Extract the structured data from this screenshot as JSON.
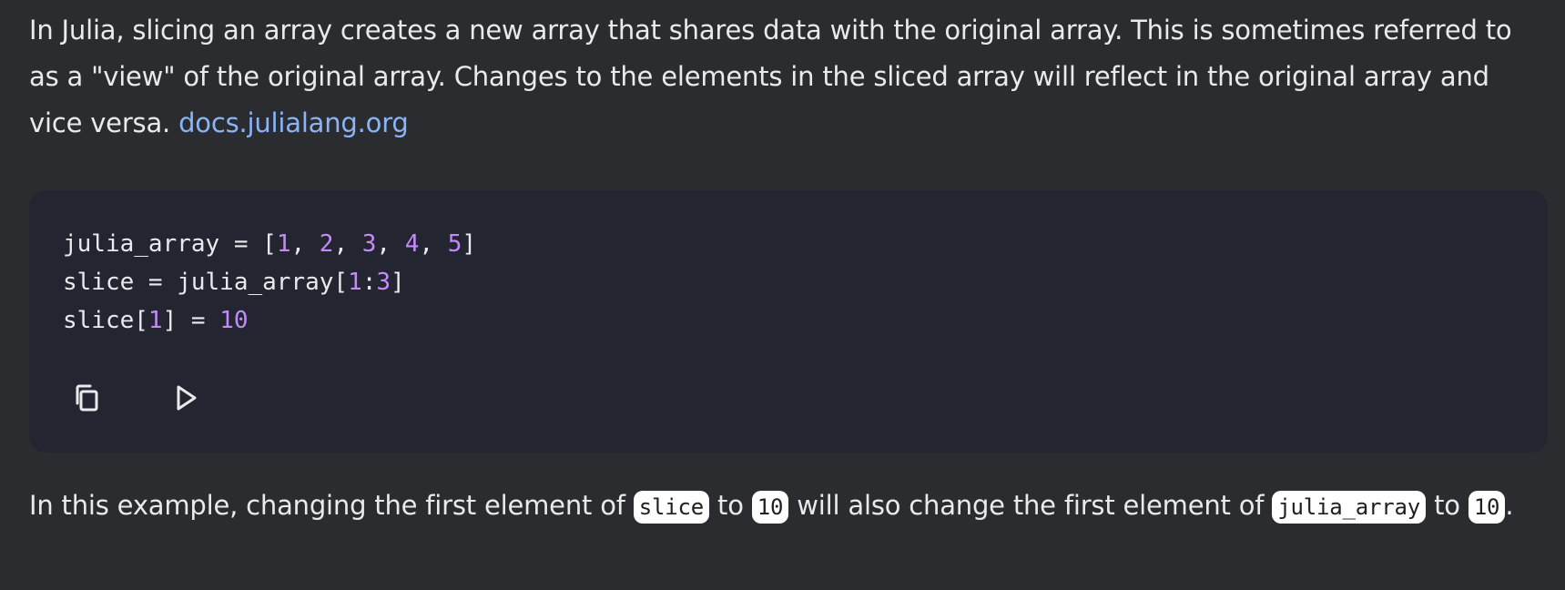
{
  "intro": {
    "text": "In Julia, slicing an array creates a new array that shares data with the original array. This is sometimes referred to as a \"view\" of the original array. Changes to the elements in the sliced array will reflect in the original array and vice versa. ",
    "link_text": "docs.julialang.org"
  },
  "code_block": {
    "lines": [
      [
        {
          "t": "julia_array = [",
          "k": "plain"
        },
        {
          "t": "1",
          "k": "num"
        },
        {
          "t": ", ",
          "k": "plain"
        },
        {
          "t": "2",
          "k": "num"
        },
        {
          "t": ", ",
          "k": "plain"
        },
        {
          "t": "3",
          "k": "num"
        },
        {
          "t": ", ",
          "k": "plain"
        },
        {
          "t": "4",
          "k": "num"
        },
        {
          "t": ", ",
          "k": "plain"
        },
        {
          "t": "5",
          "k": "num"
        },
        {
          "t": "]",
          "k": "plain"
        }
      ],
      [
        {
          "t": "slice = julia_array[",
          "k": "plain"
        },
        {
          "t": "1",
          "k": "num"
        },
        {
          "t": ":",
          "k": "plain"
        },
        {
          "t": "3",
          "k": "num"
        },
        {
          "t": "]",
          "k": "plain"
        }
      ],
      [
        {
          "t": "slice[",
          "k": "plain"
        },
        {
          "t": "1",
          "k": "num"
        },
        {
          "t": "] = ",
          "k": "plain"
        },
        {
          "t": "10",
          "k": "num"
        }
      ]
    ],
    "copy_icon": "copy-icon",
    "run_icon": "play-icon",
    "colors": {
      "background": "#232530",
      "number": "#c58af9",
      "text": "#e8eaed"
    }
  },
  "outro": {
    "part1": "In this example, changing the first element of ",
    "code1": "slice",
    "part2": " to ",
    "code2": "10",
    "part3": " will also change the first element of ",
    "code3": "julia_array",
    "part4": " to ",
    "code4": "10",
    "part5": "."
  },
  "colors": {
    "page_background": "#2b2c2f",
    "link": "#8ab4f8",
    "inline_code_background": "#ffffff"
  }
}
